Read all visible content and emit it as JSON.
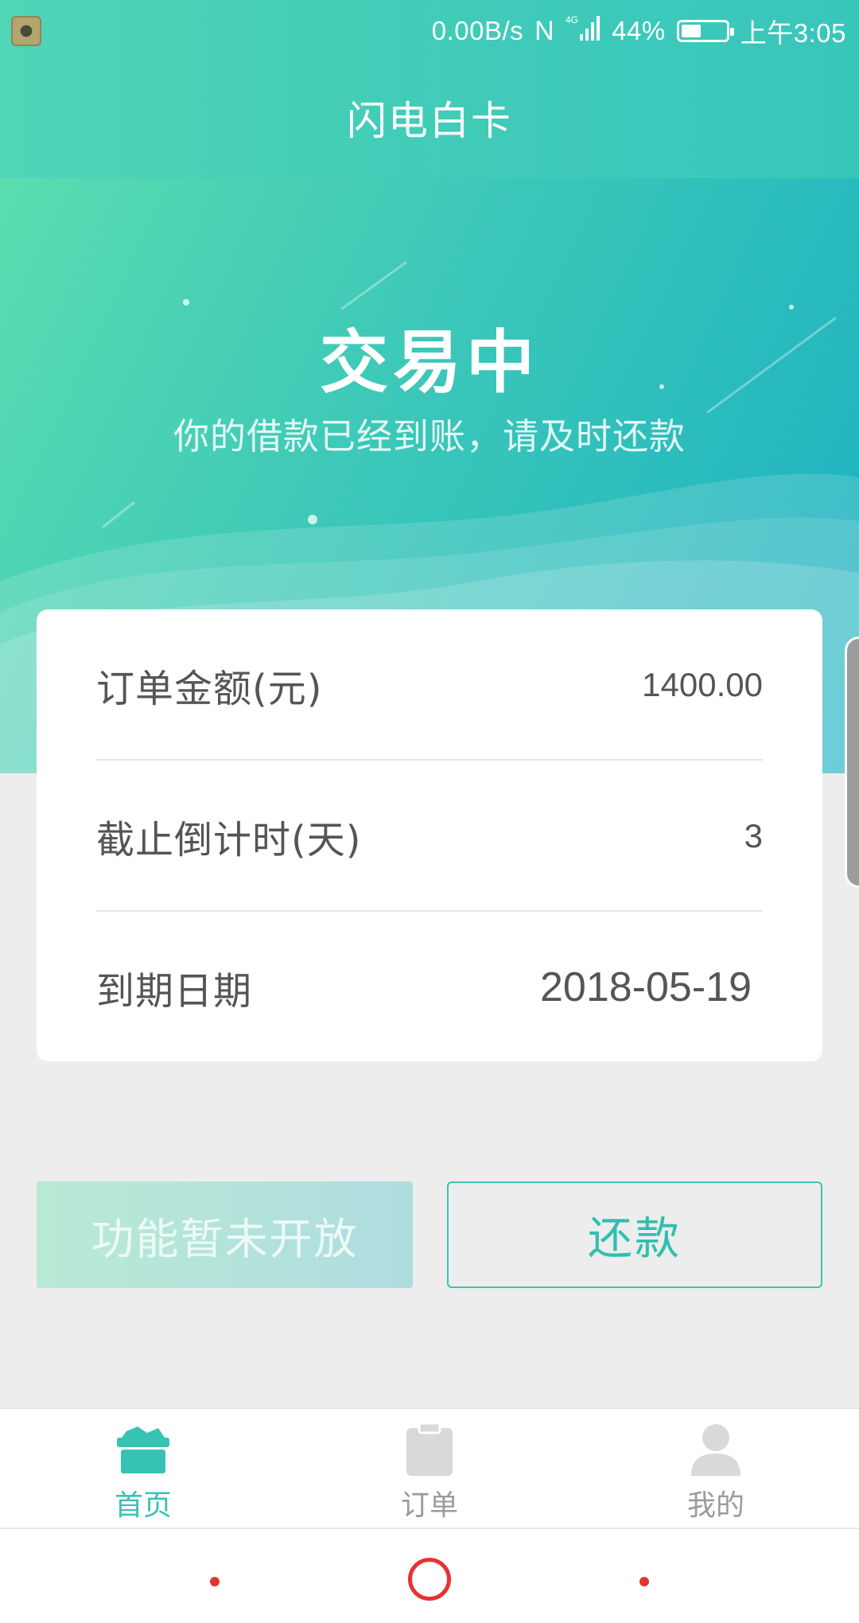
{
  "status_bar": {
    "speed": "0.00B/s",
    "nfc": "N",
    "network": "4G",
    "battery_text": "44%",
    "battery_level": 0.44,
    "time": "上午3:05"
  },
  "app": {
    "title": "闪电白卡"
  },
  "hero": {
    "status": "交易中",
    "message": "你的借款已经到账，请及时还款"
  },
  "details": {
    "rows": [
      {
        "label": "订单金额(元)",
        "value": "1400.00"
      },
      {
        "label": "截止倒计时(天)",
        "value": "3"
      },
      {
        "label": "到期日期",
        "value": "2018-05-19"
      }
    ]
  },
  "actions": {
    "disabled_label": "功能暂未开放",
    "repay_label": "还款"
  },
  "tabs": [
    {
      "label": "首页",
      "icon": "home-gift-icon",
      "active": true
    },
    {
      "label": "订单",
      "icon": "clipboard-icon",
      "active": false
    },
    {
      "label": "我的",
      "icon": "person-icon",
      "active": false
    }
  ],
  "colors": {
    "brand": "#3fcab9",
    "accent_text": "#2fbfae",
    "nav_red": "#e53333"
  }
}
